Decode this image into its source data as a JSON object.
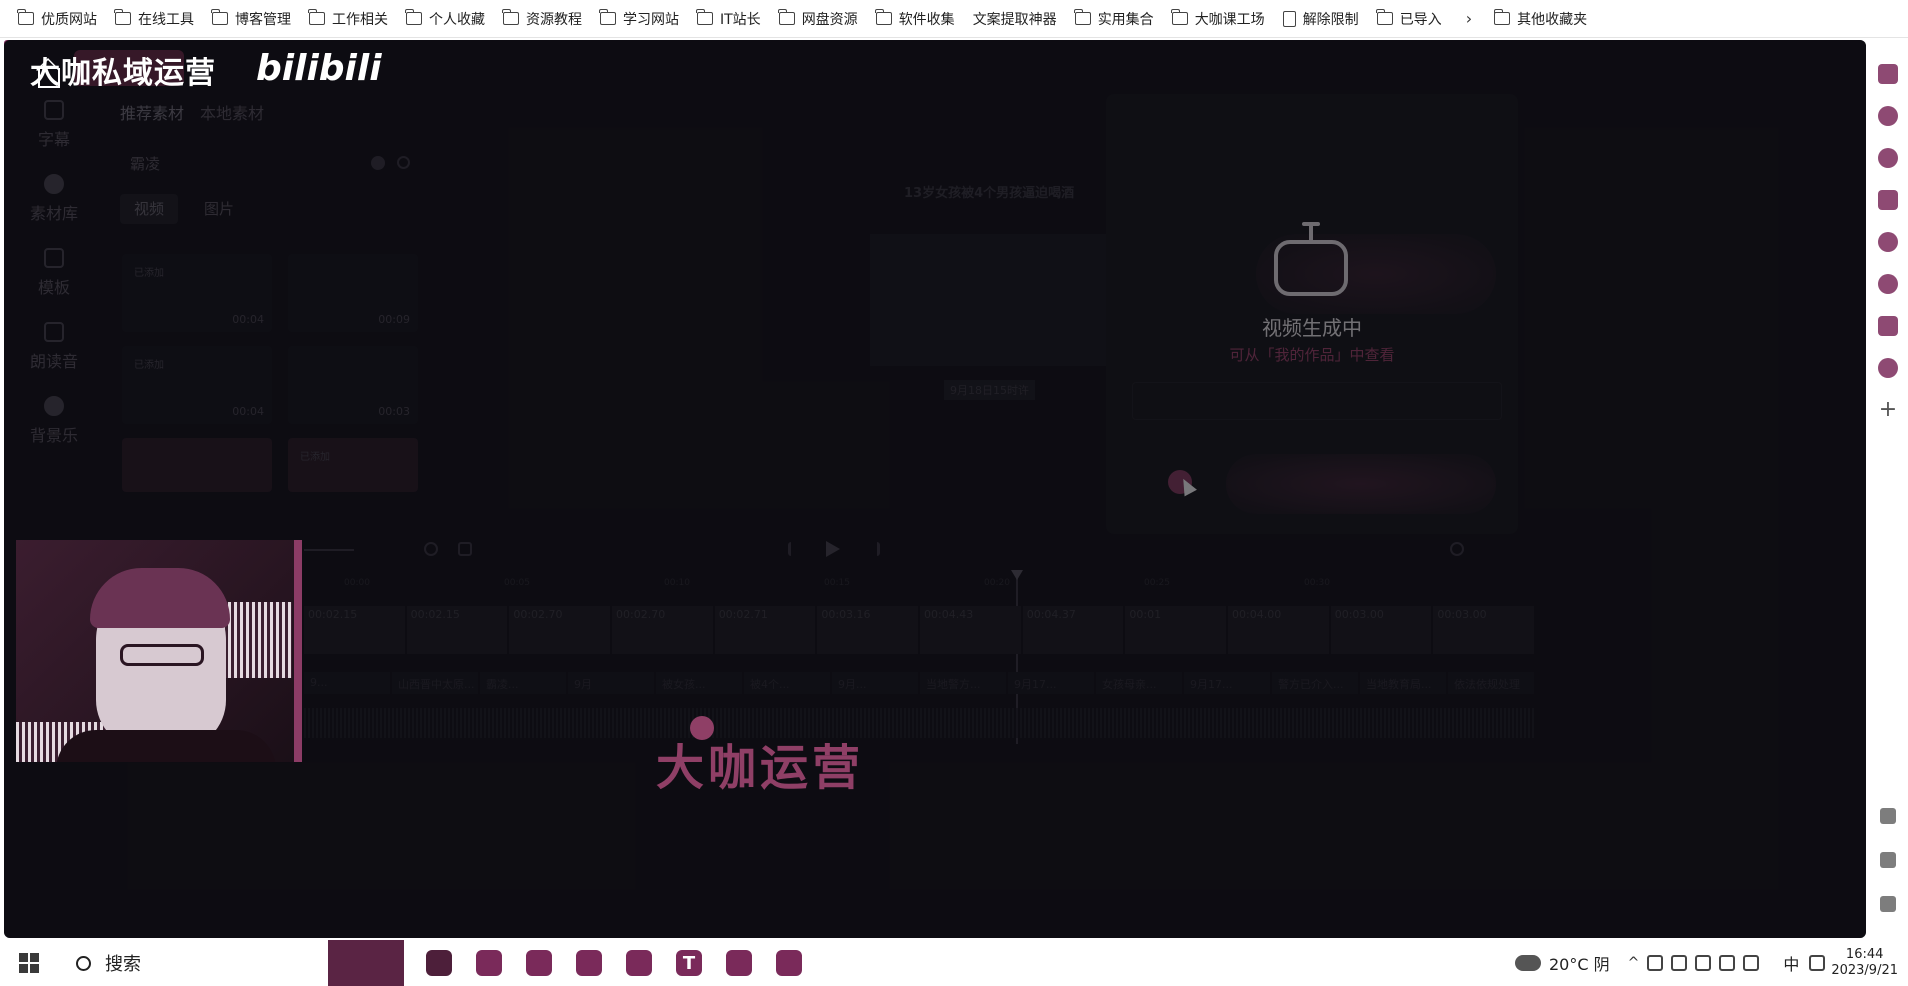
{
  "bookmarks": [
    {
      "label": "优质网站",
      "icon": "folder-icon"
    },
    {
      "label": "在线工具",
      "icon": "folder-icon"
    },
    {
      "label": "博客管理",
      "icon": "folder-icon"
    },
    {
      "label": "工作相关",
      "icon": "folder-icon"
    },
    {
      "label": "个人收藏",
      "icon": "folder-icon"
    },
    {
      "label": "资源教程",
      "icon": "folder-icon"
    },
    {
      "label": "学习网站",
      "icon": "folder-icon"
    },
    {
      "label": "IT站长",
      "icon": "folder-icon"
    },
    {
      "label": "网盘资源",
      "icon": "folder-icon"
    },
    {
      "label": "软件收集",
      "icon": "folder-icon"
    },
    {
      "label": "文案提取神器",
      "icon": "app-icon"
    },
    {
      "label": "实用集合",
      "icon": "folder-icon"
    },
    {
      "label": "大咖课工场",
      "icon": "folder-icon"
    },
    {
      "label": "解除限制",
      "icon": "document-icon"
    },
    {
      "label": "已导入",
      "icon": "folder-icon"
    }
  ],
  "other_bookmarks": "其他收藏夹",
  "brand": {
    "title": "大咖私域运营",
    "logo": "bilibili"
  },
  "left_nav": [
    {
      "label": "字幕",
      "icon": "subtitle-icon"
    },
    {
      "label": "素材库",
      "icon": "library-icon"
    },
    {
      "label": "模板",
      "icon": "template-icon"
    },
    {
      "label": "朗读音",
      "icon": "voice-icon"
    },
    {
      "label": "背景乐",
      "icon": "music-icon"
    }
  ],
  "material": {
    "tabs": [
      "推荐素材",
      "本地素材"
    ],
    "search_value": "霸凌",
    "types": [
      "视频",
      "图片"
    ],
    "thumbs": [
      {
        "tag": "已添加",
        "duration": "00:04"
      },
      {
        "tag": "",
        "duration": "00:09"
      },
      {
        "tag": "已添加",
        "duration": "00:04"
      },
      {
        "tag": "",
        "duration": "00:03"
      },
      {
        "tag": "",
        "duration": ""
      },
      {
        "tag": "已添加",
        "duration": ""
      }
    ]
  },
  "preview": {
    "title": "13岁女孩被4个男孩逼迫喝酒",
    "label": "9月18日15时许"
  },
  "modal": {
    "title": "视频生成中",
    "subtitle": "可从「我的作品」中查看"
  },
  "timeline": {
    "video_clips": [
      "00:02.15",
      "00:02.15",
      "00:02.70",
      "00:02.70",
      "00:02.71",
      "00:03.16",
      "00:04.43",
      "00:04.37",
      "00:01",
      "00:04.00",
      "00:03.00",
      "00:03.00"
    ],
    "text_clips": [
      "9...",
      "山西晋中太原...",
      "霸凌...",
      "9月",
      "被女孩...",
      "被4个...",
      "9月...",
      "当地警方...",
      "9月17...",
      "女孩母亲...",
      "9月17...",
      "警方已介入...",
      "当地教育局...",
      "依法依规处理"
    ]
  },
  "watermark": "大咖运营",
  "taskbar": {
    "search_label": "搜索",
    "weather": "20°C 阴",
    "ime": "中",
    "time": "16:44",
    "date": "2023/9/21",
    "apps": [
      {
        "label": "",
        "icon": "browser-icon"
      },
      {
        "label": "",
        "icon": "chat-icon"
      },
      {
        "label": "",
        "icon": "notes-icon"
      },
      {
        "label": "",
        "icon": "files-icon"
      },
      {
        "label": "",
        "icon": "image-icon"
      },
      {
        "label": "T",
        "icon": "typora-icon"
      },
      {
        "label": "",
        "icon": "folder-icon"
      },
      {
        "label": "",
        "icon": "settings-icon"
      }
    ]
  }
}
